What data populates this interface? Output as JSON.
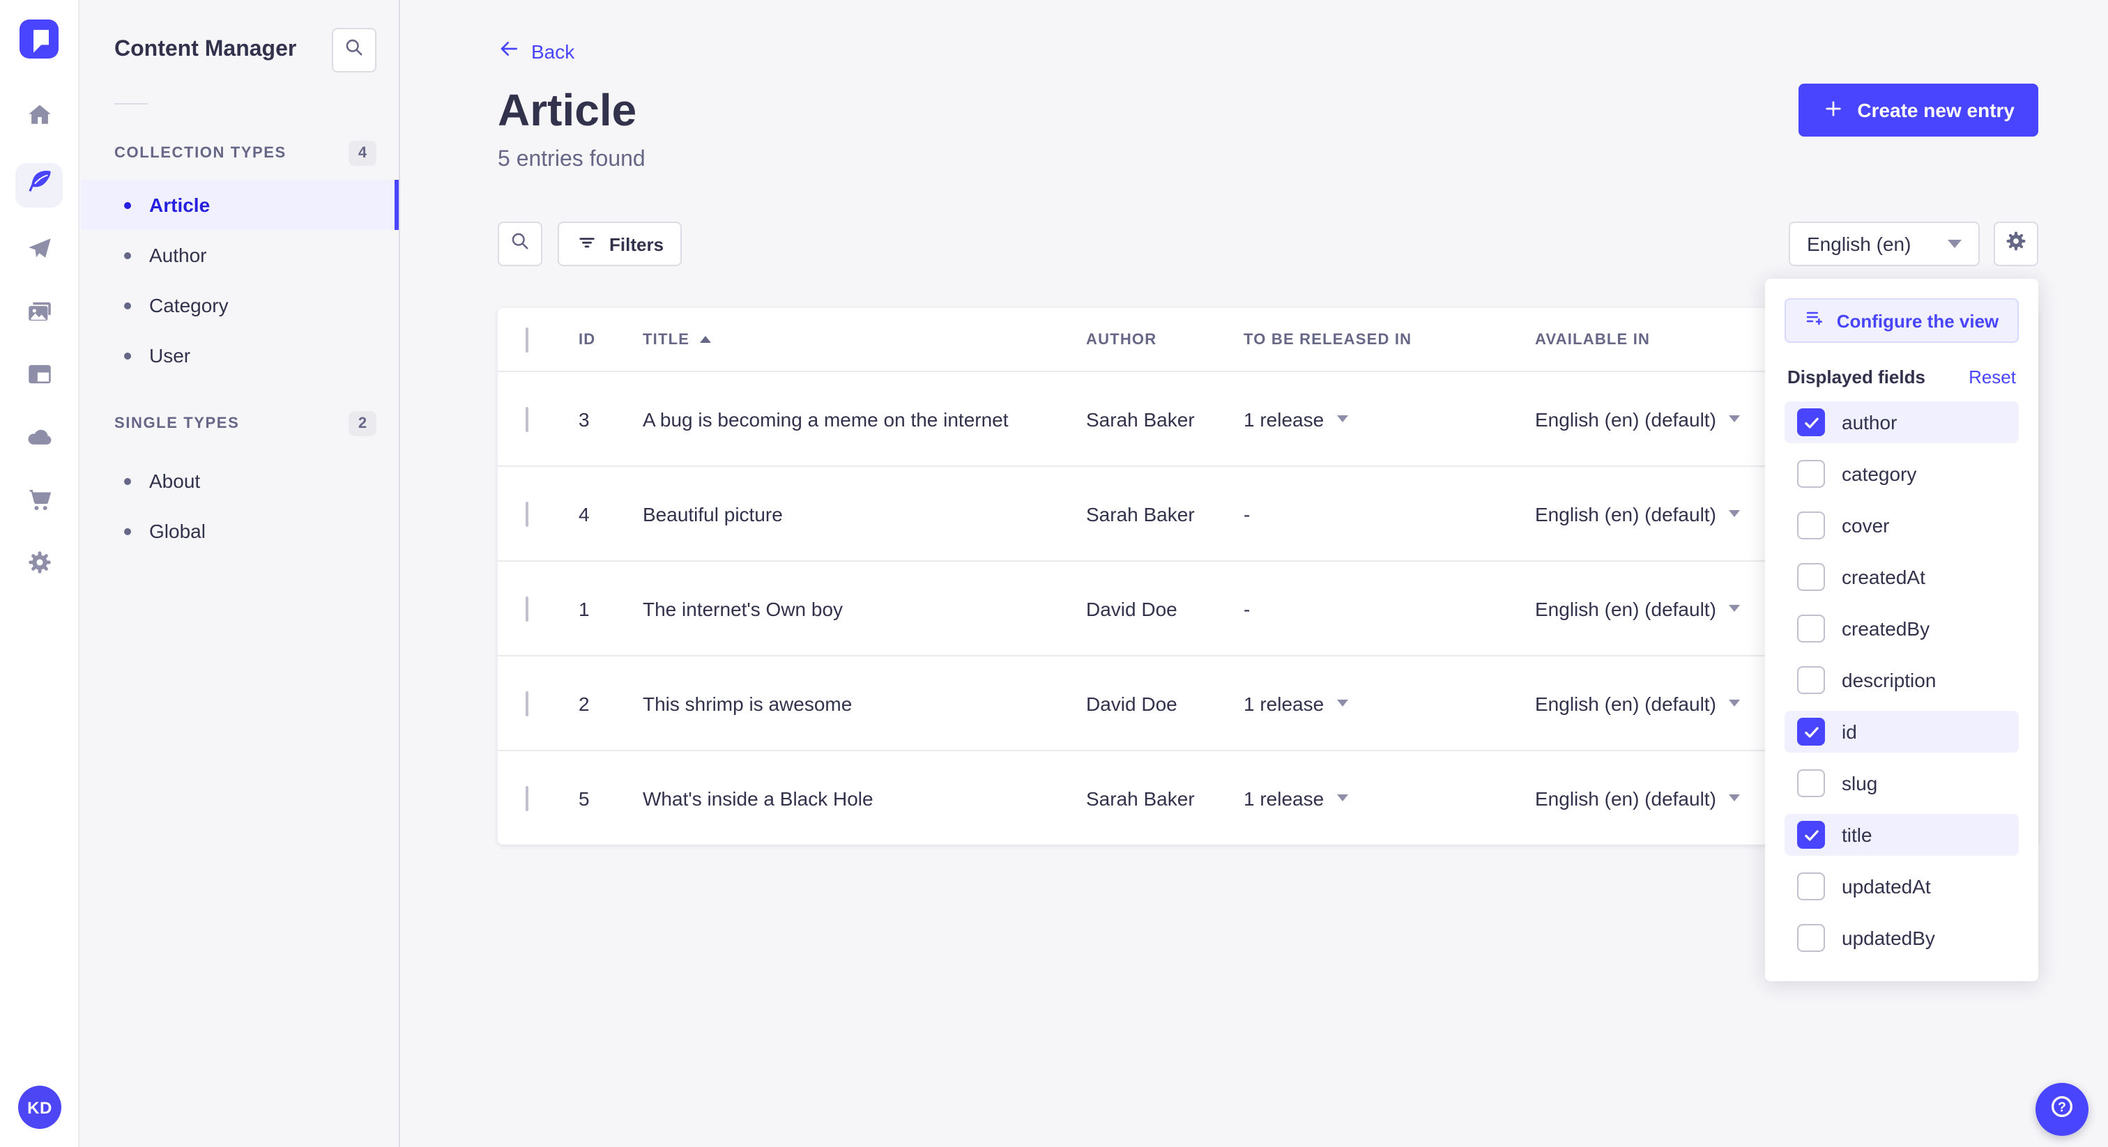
{
  "subnav": {
    "title": "Content Manager",
    "sections": [
      {
        "label": "COLLECTION TYPES",
        "count": "4",
        "items": [
          {
            "label": "Article",
            "active": true
          },
          {
            "label": "Author"
          },
          {
            "label": "Category"
          },
          {
            "label": "User"
          }
        ]
      },
      {
        "label": "SINGLE TYPES",
        "count": "2",
        "items": [
          {
            "label": "About"
          },
          {
            "label": "Global"
          }
        ]
      }
    ]
  },
  "rail": {
    "avatar_initials": "KD"
  },
  "header": {
    "back_label": "Back",
    "title": "Article",
    "subtitle": "5 entries found",
    "create_button_label": "Create new entry"
  },
  "toolbar": {
    "filters_label": "Filters",
    "locale_value": "English (en)"
  },
  "table": {
    "columns": {
      "id": "ID",
      "title": "TITLE",
      "author": "AUTHOR",
      "released": "TO BE RELEASED IN",
      "available": "AVAILABLE IN"
    },
    "rows": [
      {
        "id": "3",
        "title": "A bug is becoming a meme on the internet",
        "author": "Sarah Baker",
        "released": "1 release",
        "available": "English (en) (default)"
      },
      {
        "id": "4",
        "title": "Beautiful picture",
        "author": "Sarah Baker",
        "released": "-",
        "available": "English (en) (default)"
      },
      {
        "id": "1",
        "title": "The internet's Own boy",
        "author": "David Doe",
        "released": "-",
        "available": "English (en) (default)"
      },
      {
        "id": "2",
        "title": "This shrimp is awesome",
        "author": "David Doe",
        "released": "1 release",
        "available": "English (en) (default)"
      },
      {
        "id": "5",
        "title": "What's inside a Black Hole",
        "author": "Sarah Baker",
        "released": "1 release",
        "available": "English (en) (default)"
      }
    ]
  },
  "popover": {
    "configure_label": "Configure the view",
    "fields_title": "Displayed fields",
    "reset_label": "Reset",
    "fields": [
      {
        "label": "author",
        "checked": true
      },
      {
        "label": "category",
        "checked": false
      },
      {
        "label": "cover",
        "checked": false
      },
      {
        "label": "createdAt",
        "checked": false
      },
      {
        "label": "createdBy",
        "checked": false
      },
      {
        "label": "description",
        "checked": false
      },
      {
        "label": "id",
        "checked": true
      },
      {
        "label": "slug",
        "checked": false
      },
      {
        "label": "title",
        "checked": true
      },
      {
        "label": "updatedAt",
        "checked": false
      },
      {
        "label": "updatedBy",
        "checked": false
      }
    ]
  },
  "icons": {
    "home": "house",
    "content_manager": "feather",
    "releases": "paper-plane",
    "media_library": "pictures",
    "content_type_builder": "layout",
    "deploy": "cloud",
    "marketplace": "cart",
    "settings": "gear",
    "search": "magnifier",
    "filters": "filter-lines",
    "configure": "lines-plus",
    "help": "question-circle"
  },
  "colors": {
    "primary": "#4945FF",
    "primary_active_text": "#271FE0",
    "primary_light": "#F0F0FF",
    "text": "#32324D",
    "text_secondary": "#666687",
    "background": "#F6F6F9"
  }
}
